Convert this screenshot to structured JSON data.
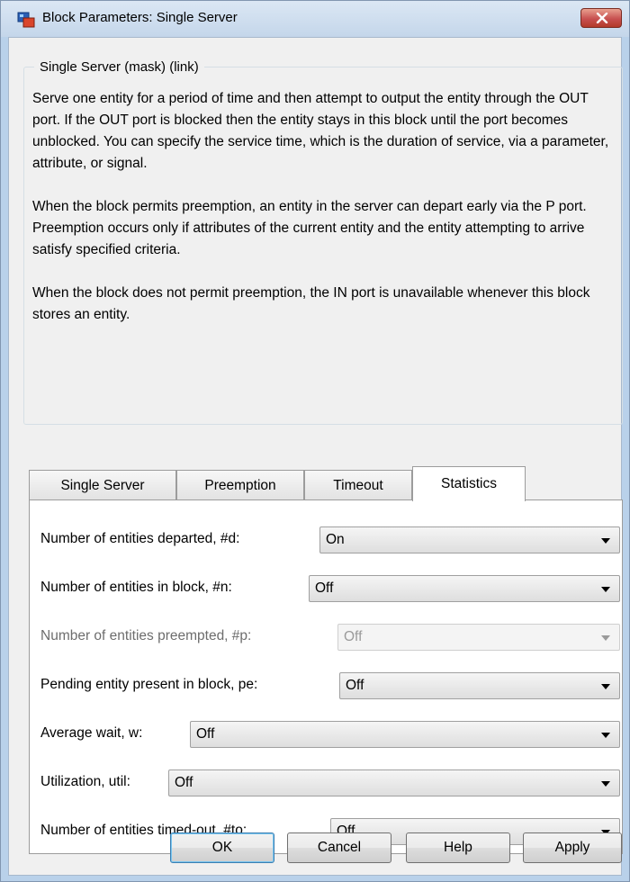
{
  "window": {
    "title": "Block Parameters: Single Server"
  },
  "group": {
    "title": "Single Server (mask) (link)",
    "description": [
      "Serve one entity for a period of time and then attempt to output the entity through the OUT port. If the OUT port is blocked then the entity stays in this block until the port becomes unblocked. You can specify the service time, which is the duration of service, via a parameter, attribute, or signal.",
      "When the block permits preemption, an entity in the server can depart early via the P port. Preemption occurs only if attributes of the current entity and the entity attempting to arrive satisfy specified criteria.",
      "When the block does not permit preemption, the IN port is unavailable whenever this block stores an entity."
    ]
  },
  "tabs": [
    {
      "label": "Single Server"
    },
    {
      "label": "Preemption"
    },
    {
      "label": "Timeout"
    },
    {
      "label": "Statistics"
    }
  ],
  "active_tab": "Statistics",
  "params": [
    {
      "label": "Number of entities departed, #d:",
      "value": "On",
      "enabled": true
    },
    {
      "label": "Number of entities in block, #n:",
      "value": "Off",
      "enabled": true
    },
    {
      "label": "Number of entities preempted, #p:",
      "value": "Off",
      "enabled": false
    },
    {
      "label": "Pending entity present in block, pe:",
      "value": "Off",
      "enabled": true
    },
    {
      "label": "Average wait, w:",
      "value": "Off",
      "enabled": true
    },
    {
      "label": "Utilization, util:",
      "value": "Off",
      "enabled": true
    },
    {
      "label": "Number of entities timed-out, #to:",
      "value": "Off",
      "enabled": true
    }
  ],
  "buttons": {
    "ok": "OK",
    "cancel": "Cancel",
    "help": "Help",
    "apply": "Apply"
  },
  "icons": {
    "app": "simulink-block-icon",
    "close": "close-icon"
  },
  "colors": {
    "title_bar": "#c4d6ea",
    "close_button": "#c75050",
    "dialog_bg": "#f0f0f0"
  }
}
